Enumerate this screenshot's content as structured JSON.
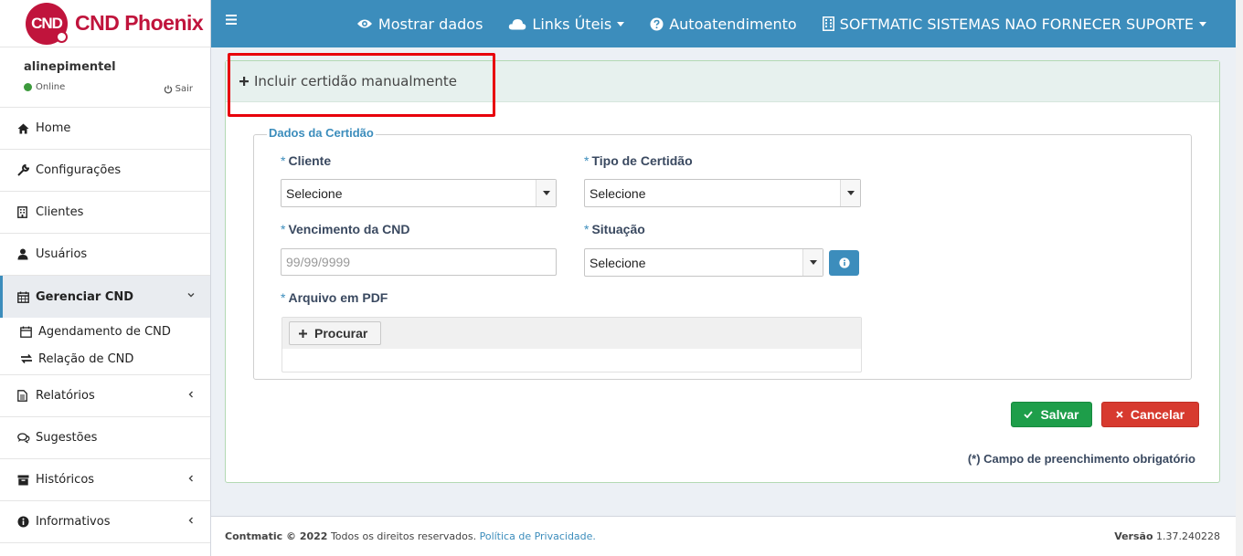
{
  "brand": {
    "logo_text": "CND",
    "name": "CND Phoenix"
  },
  "user": {
    "name": "alinepimentel",
    "status": "Online",
    "logout": "Sair"
  },
  "sidebar": {
    "items": [
      {
        "label": "Home",
        "icon": "home-icon"
      },
      {
        "label": "Configurações",
        "icon": "wrench-icon"
      },
      {
        "label": "Clientes",
        "icon": "building-icon"
      },
      {
        "label": "Usuários",
        "icon": "user-icon"
      },
      {
        "label": "Gerenciar CND",
        "icon": "calendar-icon"
      },
      {
        "label": "Relatórios",
        "icon": "file-icon"
      },
      {
        "label": "Sugestões",
        "icon": "comments-icon"
      },
      {
        "label": "Históricos",
        "icon": "archive-icon"
      },
      {
        "label": "Informativos",
        "icon": "info-icon"
      }
    ],
    "subitems": [
      {
        "label": "Agendamento de CND",
        "icon": "calendar-empty-icon"
      },
      {
        "label": "Relação de CND",
        "icon": "exchange-icon"
      }
    ]
  },
  "topbar": {
    "mostrar_dados": "Mostrar dados",
    "links_uteis": "Links Úteis",
    "autoatendimento": "Autoatendimento",
    "company": "SOFTMATIC SISTEMAS NAO FORNECER SUPORTE"
  },
  "panel": {
    "header": "Incluir certidão manualmente",
    "legend": "Dados da Certidão",
    "fields": {
      "cliente": {
        "label": "Cliente",
        "value": "Selecione"
      },
      "tipo": {
        "label": "Tipo de Certidão",
        "value": "Selecione"
      },
      "vencimento": {
        "label": "Vencimento da CND",
        "placeholder": "99/99/9999"
      },
      "situacao": {
        "label": "Situação",
        "value": "Selecione"
      },
      "arquivo": {
        "label": "Arquivo em PDF",
        "button": "Procurar"
      }
    },
    "required_mark": "*",
    "save": "Salvar",
    "cancel": "Cancelar",
    "required_note": "(*) Campo de preenchimento obrigatório"
  },
  "footer": {
    "company": "Contmatic © 2022",
    "rights": "Todos os direitos reservados.",
    "privacy": "Política de Privacidade.",
    "version_label": "Versão",
    "version": "1.37.240228"
  },
  "colors": {
    "topbar": "#3c8dbc",
    "brand": "#c0143c",
    "save": "#1e9e4a",
    "cancel": "#d73a2f",
    "highlight": "#e8000b"
  }
}
